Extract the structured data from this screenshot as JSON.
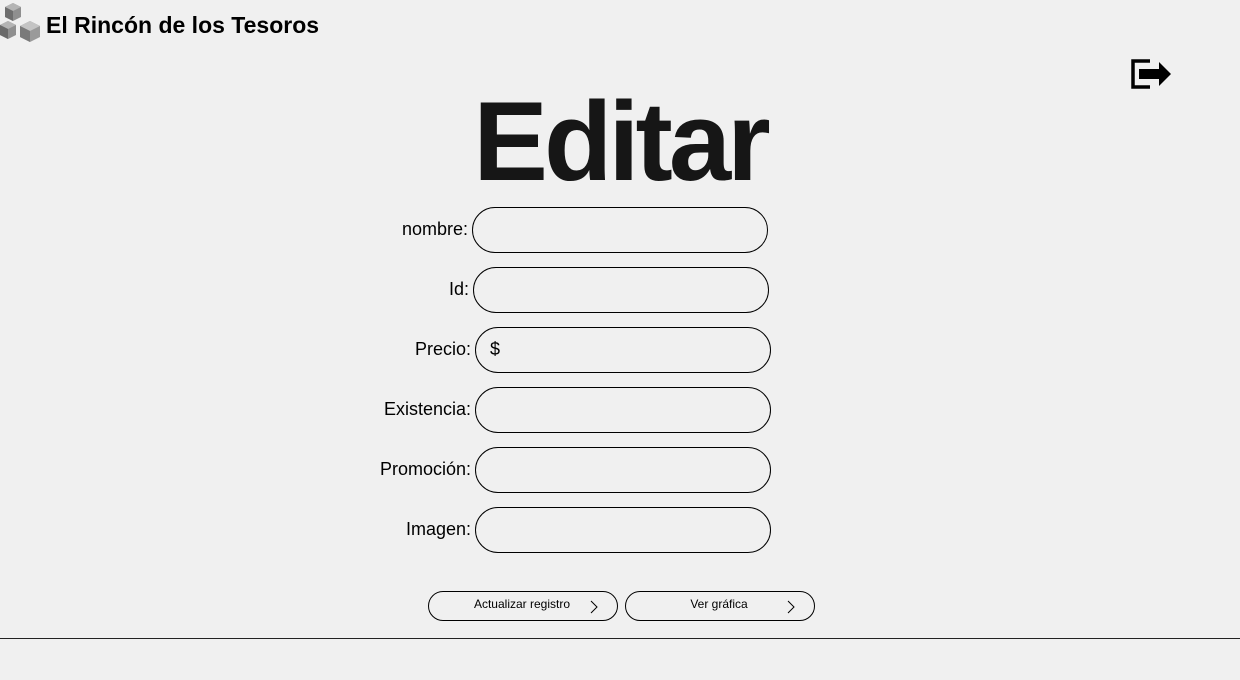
{
  "header": {
    "brand_name": "El Rincón de los Tesoros",
    "logo_icon": "cubes-logo-icon",
    "logout_icon": "logout-icon"
  },
  "main": {
    "title": "Editar",
    "fields": {
      "nombre": {
        "label": "nombre:",
        "value": ""
      },
      "id": {
        "label": "Id:",
        "value": ""
      },
      "precio": {
        "label": "Precio:",
        "prefix": "$",
        "value": ""
      },
      "existencia": {
        "label": "Existencia:",
        "value": ""
      },
      "promocion": {
        "label": "Promoción:",
        "value": ""
      },
      "imagen": {
        "label": "Imagen:",
        "value": ""
      }
    },
    "buttons": {
      "update_label": "Actualizar registro",
      "chart_label": "Ver gráfica",
      "chevron_icon": "chevron-right-icon"
    }
  },
  "colors": {
    "background": "#f0f0f0",
    "text": "#000000",
    "title": "#161616"
  }
}
